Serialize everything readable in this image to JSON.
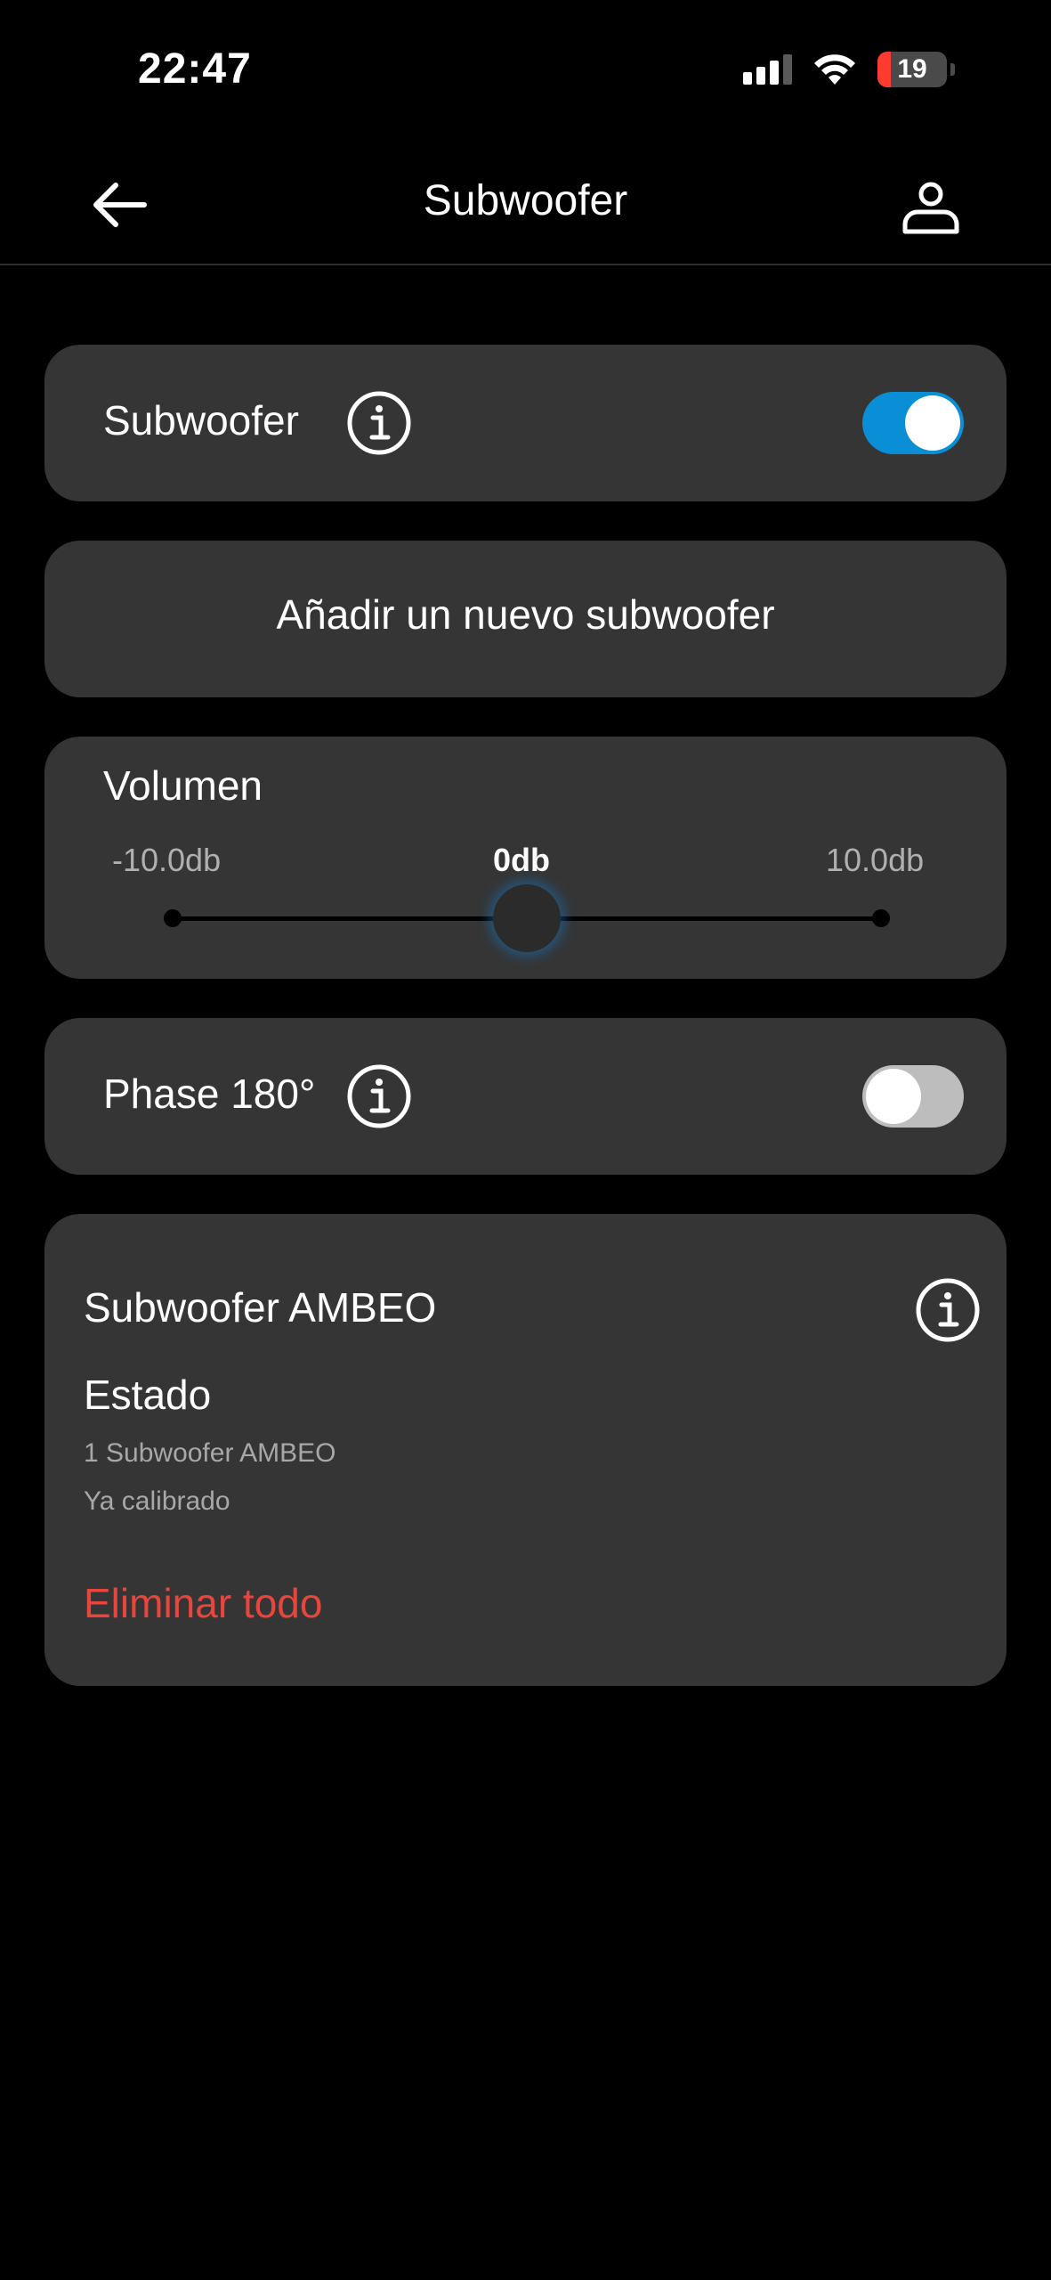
{
  "status_bar": {
    "time": "22:47",
    "battery": "19",
    "battery_level": 0.19
  },
  "nav": {
    "title": "Subwoofer"
  },
  "subwoofer_row": {
    "label": "Subwoofer",
    "enabled": true
  },
  "add_button": {
    "label": "Añadir un nuevo subwoofer"
  },
  "volume": {
    "label": "Volumen",
    "min_label": "-10.0db",
    "current_label": "0db",
    "max_label": "10.0db",
    "min": -10.0,
    "max": 10.0,
    "value": 0
  },
  "phase_row": {
    "label": "Phase 180°",
    "enabled": false
  },
  "ambeo": {
    "title": "Subwoofer AMBEO",
    "status_title": "Estado",
    "status_line1": "1 Subwoofer AMBEO",
    "status_line2": "Ya calibrado",
    "remove_all_label": "Eliminar todo"
  },
  "colors": {
    "accent": "#0a8fd6",
    "danger": "#e8453c",
    "card": "#353535",
    "background": "#000000"
  }
}
